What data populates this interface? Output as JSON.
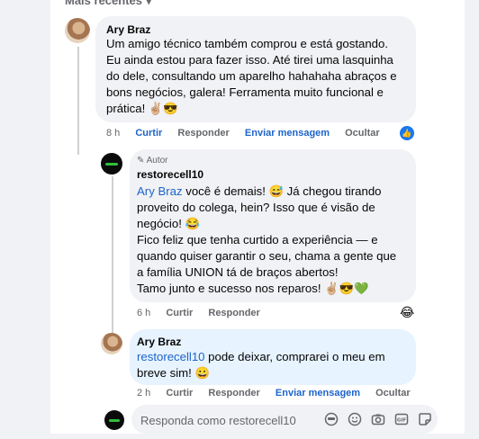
{
  "sort_label": "Mais recentes",
  "comments": [
    {
      "author": "Ary Braz",
      "lines": [
        "Um amigo técnico também comprou e está gostando.",
        "Eu ainda estou para fazer isso. Até tirei uma lasquinha",
        "do dele, consultando um aparelho hahahaha abraços e",
        "bons negócios, galera! Ferramenta muito funcional e",
        "prática! ✌🏼😎"
      ],
      "time": "8 h",
      "like": "Curtir",
      "reply": "Responder",
      "message": "Enviar mensagem",
      "hide": "Ocultar",
      "reaction": "like"
    }
  ],
  "reply1": {
    "badge": "Autor",
    "author": "restorecell10",
    "mention": "Ary Braz",
    "line1_rest": " você é demais! 😅 Já chegou tirando",
    "lines": [
      "proveito do colega, hein? Isso que é visão de",
      "negócio! 😂",
      "Fico feliz que tenha curtido a experiência — e",
      "quando quiser garantir o seu, chama a gente que",
      "a família UNION tá de braços abertos!",
      "Tamo junto e sucesso nos reparos! ✌🏼😎💚"
    ],
    "time": "6 h",
    "like": "Curtir",
    "reply": "Responder",
    "reaction": "😂"
  },
  "reply2": {
    "author": "Ary Braz",
    "mention": "restorecell10",
    "line1_rest": " pode deixar, comprarei o meu em",
    "line2": "breve sim! 😀",
    "time": "2 h",
    "like": "Curtir",
    "reply": "Responder",
    "message": "Enviar mensagem",
    "hide": "Ocultar"
  },
  "composer": {
    "placeholder": "Responda como restorecell10",
    "tools": [
      "avatar-sticker-icon",
      "emoji-icon",
      "camera-icon",
      "gif-icon",
      "sticker-icon"
    ]
  }
}
